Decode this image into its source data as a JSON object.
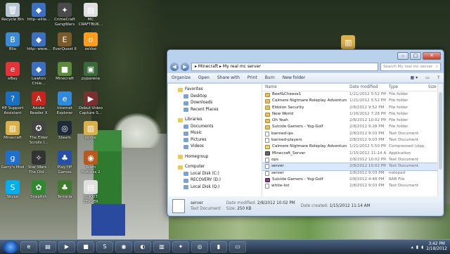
{
  "desktop": {
    "icons": [
      {
        "label": "Recycle Bin",
        "glyph": "🗑",
        "color": "#b8c6d4"
      },
      {
        "label": "http--elite...",
        "glyph": "◆",
        "color": "#3b6fc2"
      },
      {
        "label": "CrimeCraft GangWars",
        "glyph": "✦",
        "color": "#4a4a4a"
      },
      {
        "label": "MC CRAFTBUK...",
        "glyph": "▤",
        "color": "#e0e0e0"
      },
      {
        "label": "Blio",
        "glyph": "B",
        "color": "#3b8ad8"
      },
      {
        "label": "http--www...",
        "glyph": "◆",
        "color": "#3b6fc2"
      },
      {
        "label": "EverQuest II",
        "glyph": "E",
        "color": "#7a5a2a"
      },
      {
        "label": "ooVoo",
        "glyph": "o",
        "color": "#ff9d1c"
      },
      {
        "label": "eBay",
        "glyph": "e",
        "color": "#e53238"
      },
      {
        "label": "Lawton Chile...",
        "glyph": "◆",
        "color": "#3b6fc2"
      },
      {
        "label": "Minecraft",
        "glyph": "■",
        "color": "#5a8a3a"
      },
      {
        "label": "pyparena",
        "glyph": "▣",
        "color": "#3a6a3a"
      },
      {
        "label": "HP Support Assistant",
        "glyph": "?",
        "color": "#1b6fc2"
      },
      {
        "label": "Adobe Reader X",
        "glyph": "A",
        "color": "#c8241c"
      },
      {
        "label": "Internet Explorer",
        "glyph": "e",
        "color": "#2f8ade"
      },
      {
        "label": "Debut Video Capture S...",
        "glyph": "▶",
        "color": "#7a3030"
      },
      {
        "label": "Minecraft",
        "glyph": "▥",
        "color": "#d9b04a"
      },
      {
        "label": "The Elder Scrolls I...",
        "glyph": "✪",
        "color": "#444"
      },
      {
        "label": "Steam",
        "glyph": "◎",
        "color": "#1c2a3a"
      },
      {
        "label": "ooVoo",
        "glyph": "▥",
        "color": "#d9b04a"
      },
      {
        "label": "Garry's Mod",
        "glyph": "g",
        "color": "#1f6fd1"
      },
      {
        "label": "Star Wars - The Old ...",
        "glyph": "✧",
        "color": "#333"
      },
      {
        "label": "Play HP Games",
        "glyph": "♣",
        "color": "#2650a8"
      },
      {
        "label": "Team Fortress 2",
        "glyph": "◉",
        "color": "#b85a20"
      },
      {
        "label": "Skype",
        "glyph": "S",
        "color": "#00aff0"
      },
      {
        "label": "Snapfish",
        "glyph": "✿",
        "color": "#2f8a2f"
      },
      {
        "label": "Terraria",
        "glyph": "♣",
        "color": "#3f7a2f"
      },
      {
        "label": "BUKKIT SERVER",
        "glyph": "▤",
        "color": "#e0e0e0"
      },
      {
        "label": "Server",
        "glyph": "▥",
        "color": "#d9b04a"
      }
    ]
  },
  "window": {
    "breadcrumb": [
      "Minecraft",
      "My real mc server"
    ],
    "search_placeholder": "Search My real mc server",
    "toolbar": {
      "organize": "Organize",
      "open": "Open",
      "share_with": "Share with",
      "print": "Print",
      "burn": "Burn",
      "new_folder": "New folder"
    },
    "nav": [
      {
        "label": "Favorites",
        "type": "header"
      },
      {
        "label": "Desktop",
        "type": "item"
      },
      {
        "label": "Downloads",
        "type": "item"
      },
      {
        "label": "Recent Places",
        "type": "item"
      },
      {
        "label": "",
        "type": "gap"
      },
      {
        "label": "Libraries",
        "type": "header"
      },
      {
        "label": "Documents",
        "type": "item"
      },
      {
        "label": "Music",
        "type": "item"
      },
      {
        "label": "Pictures",
        "type": "item"
      },
      {
        "label": "Videos",
        "type": "item"
      },
      {
        "label": "",
        "type": "gap"
      },
      {
        "label": "Homegroup",
        "type": "header"
      },
      {
        "label": "",
        "type": "gap"
      },
      {
        "label": "Computer",
        "type": "header"
      },
      {
        "label": "Local Disk (C:)",
        "type": "item"
      },
      {
        "label": "RECOVERY (D:)",
        "type": "item"
      },
      {
        "label": "Local Disk (Q:)",
        "type": "item"
      }
    ],
    "columns": {
      "name": "Name",
      "date": "Date modified",
      "type": "Type",
      "size": "Size"
    },
    "files": [
      {
        "name": "Beef&Cheese1",
        "date": "1/21/2012 5:52 PM",
        "type": "File folder",
        "size": "",
        "icon": "folder",
        "selected": false
      },
      {
        "name": "Calmere Nigtmare Roleplay Adventure",
        "date": "1/21/2012 5:52 PM",
        "type": "File folder",
        "size": "",
        "icon": "folder",
        "selected": false
      },
      {
        "name": "Eldolon Security",
        "date": "2/8/2012 9:52 PM",
        "type": "File folder",
        "size": "",
        "icon": "folder",
        "selected": false
      },
      {
        "name": "New World",
        "date": "1/16/2012 7:26 PM",
        "type": "File folder",
        "size": "",
        "icon": "folder",
        "selected": false
      },
      {
        "name": "Oh Yeah",
        "date": "2/8/2012 10:02 PM",
        "type": "File folder",
        "size": "",
        "icon": "folder",
        "selected": false
      },
      {
        "name": "Suicide Gamers - Yog-Golf",
        "date": "2/8/2012 9:28 PM",
        "type": "File folder",
        "size": "",
        "icon": "folder",
        "selected": false
      },
      {
        "name": "banned-ips",
        "date": "2/8/2012 9:03 PM",
        "type": "Text Document",
        "size": "",
        "icon": "doc",
        "selected": false
      },
      {
        "name": "banned-players",
        "date": "2/8/2012 9:03 PM",
        "type": "Text Document",
        "size": "",
        "icon": "doc",
        "selected": false
      },
      {
        "name": "Calmere Nigtmare Roleplay Adventure",
        "date": "1/21/2012 5:50 PM",
        "type": "Compressed (zipp...",
        "size": "",
        "icon": "zip",
        "selected": false
      },
      {
        "name": "Minecraft_Server",
        "date": "1/15/2012 11:14 AM",
        "type": "Application",
        "size": "",
        "icon": "app",
        "selected": false
      },
      {
        "name": "ops",
        "date": "2/8/2012 10:02 PM",
        "type": "Text Document",
        "size": "",
        "icon": "doc",
        "selected": false
      },
      {
        "name": "server",
        "date": "2/8/2012 10:02 PM",
        "type": "Text Document",
        "size": "",
        "icon": "doc",
        "selected": true
      },
      {
        "name": "server",
        "date": "2/8/2012 9:03 PM",
        "type": "notepad",
        "size": "",
        "icon": "doc",
        "selected": false
      },
      {
        "name": "Suicide Gamers - Yog-Golf",
        "date": "2/8/2012 4:48 PM",
        "type": "RAR File",
        "size": "",
        "icon": "rar",
        "selected": false
      },
      {
        "name": "white-list",
        "date": "2/8/2012 9:03 PM",
        "type": "Text Document",
        "size": "",
        "icon": "doc",
        "selected": false
      }
    ],
    "details": {
      "name": "server",
      "kind": "Text Document",
      "date_modified_label": "Date modified:",
      "date_modified": "2/8/2012 10:02 PM",
      "date_created_label": "Date created:",
      "date_created": "1/15/2012 11:14 AM",
      "size_label": "Size:",
      "size": "250 KB"
    }
  },
  "taskbar": {
    "time": "3:42 PM",
    "date": "2/18/2012"
  }
}
